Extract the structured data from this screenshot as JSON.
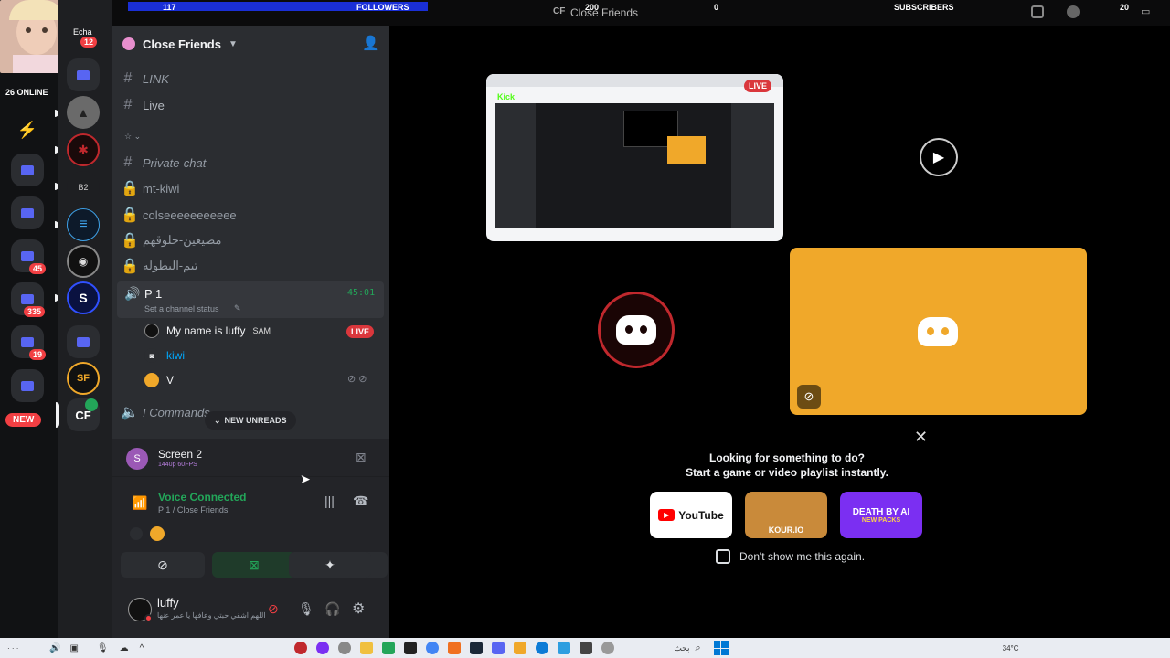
{
  "overlay": {
    "followers_count": "117",
    "followers_label": "FOLLOWERS",
    "center_count": "200",
    "center_title": "Close Friends",
    "subscribers_count": "0",
    "subscribers_label": "SUBSCRIBERS",
    "right_count": "20",
    "online_label": "26 ONLINE",
    "webcam_badge": "12",
    "kick_label": "Kick"
  },
  "rail": {
    "badges": [
      "45",
      "335",
      "19"
    ],
    "new_label": "NEW"
  },
  "server": {
    "name": "Close Friends"
  },
  "channels": [
    {
      "icon": "#",
      "name": "LINK"
    },
    {
      "icon": "#",
      "name": "Live"
    },
    {
      "icon": "#",
      "name": "Private-chat"
    },
    {
      "icon": "lock",
      "name": "mt-kiwi"
    },
    {
      "icon": "lock",
      "name": "colseeeeeeeeeee"
    },
    {
      "icon": "lock",
      "name": "مضيعين-حلوقهم"
    },
    {
      "icon": "lock",
      "name": "تيم-البطوله"
    }
  ],
  "category_label": "☆ ⌄",
  "voice_channel": {
    "name": "P 1",
    "timer": "45:01",
    "status_placeholder": "Set a channel status",
    "users": [
      {
        "name": "My name is luffy",
        "tag": "SAM",
        "live": "LIVE"
      },
      {
        "name": "kiwi"
      },
      {
        "name": "V"
      }
    ]
  },
  "commands_channel": "! Commands",
  "new_unreads": "NEW UNREADS",
  "stream_panel": {
    "title": "Screen 2",
    "quality": "1440p 60FPS"
  },
  "voice_panel": {
    "status": "Voice Connected",
    "location": "P 1 / Close Friends"
  },
  "user": {
    "name": "luffy",
    "status": "اللهم اشفي حبتي وعافها يا عمر عنها"
  },
  "stage": {
    "live_badge": "LIVE"
  },
  "activity": {
    "title": "Looking for something to do?",
    "subtitle": "Start a game or video playlist instantly.",
    "apps": [
      {
        "name": "YouTube"
      },
      {
        "name": "KOUR.IO"
      },
      {
        "name": "DEATH BY AI",
        "sub": "NEW PACKS"
      }
    ],
    "dont_show": "Don't show me this again."
  },
  "taskbar": {
    "search_label": "بحث",
    "temp": "34°C"
  },
  "colors": {
    "accent": "#5865f2",
    "green": "#23a559",
    "orange": "#f0a82a",
    "live_red": "#da373c"
  }
}
